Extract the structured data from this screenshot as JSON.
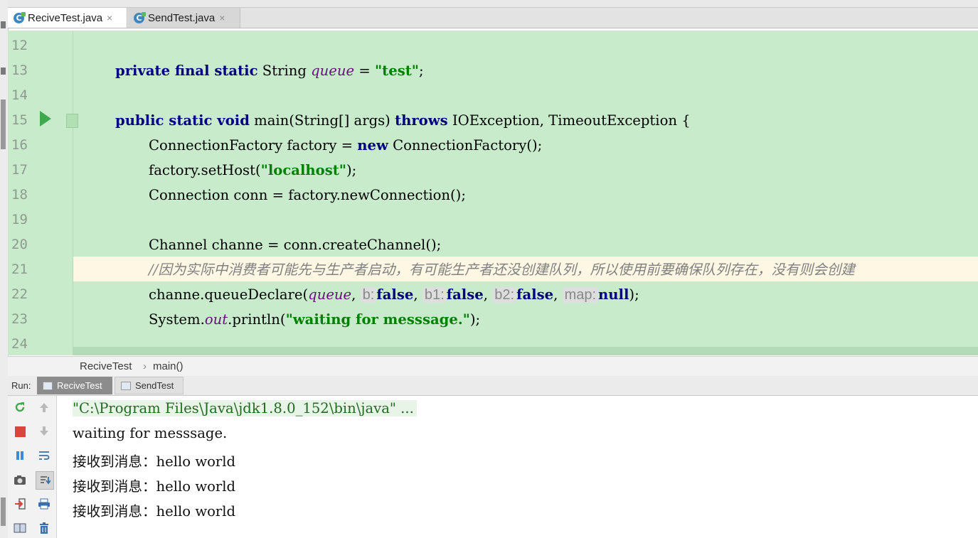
{
  "tabs": [
    {
      "label": "ReciveTest.java",
      "active": true
    },
    {
      "label": "SendTest.java",
      "active": false
    }
  ],
  "tab_close_glyph": "×",
  "editor": {
    "lines": [
      {
        "num": "12"
      },
      {
        "num": "13"
      },
      {
        "num": "14"
      },
      {
        "num": "15"
      },
      {
        "num": "16"
      },
      {
        "num": "17"
      },
      {
        "num": "18"
      },
      {
        "num": "19"
      },
      {
        "num": "20"
      },
      {
        "num": "21"
      },
      {
        "num": "22"
      },
      {
        "num": "23"
      },
      {
        "num": "24"
      }
    ],
    "code": {
      "l13": {
        "kw": "private final static",
        "type": " String ",
        "field": "queue",
        "eq": " = ",
        "str": "\"test\"",
        "end": ";"
      },
      "l15": {
        "kw1": "public static void",
        "mid": " main(String[] args) ",
        "kw2": "throws",
        "end": " IOException, TimeoutException {"
      },
      "l16": {
        "pre": "ConnectionFactory factory = ",
        "kw": "new",
        "end": " ConnectionFactory();"
      },
      "l17": {
        "pre": "factory.setHost(",
        "str": "\"localhost\"",
        "end": ");"
      },
      "l18": {
        "text": "Connection conn = factory.newConnection();"
      },
      "l20": {
        "text": "Channel channe = conn.createChannel();"
      },
      "l21": {
        "comment": "//因为实际中消费者可能先与生产者启动，有可能生产者还没创建队列，所以使用前要确保队列存在，没有则会创建"
      },
      "l22": {
        "pre": "channe.queueDeclare(",
        "field": "queue",
        "c1": ", ",
        "h1": "b:",
        "v1": "false",
        "c2": ", ",
        "h2": "b1:",
        "v2": "false",
        "c3": ", ",
        "h3": "b2:",
        "v3": "false",
        "c4": ", ",
        "h4": "map:",
        "v4": "null",
        "end": ");"
      },
      "l23": {
        "pre": "System.",
        "field": "out",
        "mid": ".println(",
        "str": "\"waiting for messsage.\"",
        "end": ");"
      }
    }
  },
  "breadcrumb": {
    "class": "ReciveTest",
    "sep": "›",
    "method": "main()"
  },
  "run": {
    "label": "Run:",
    "tabs": [
      {
        "label": "ReciveTest",
        "active": true
      },
      {
        "label": "SendTest",
        "active": false
      }
    ]
  },
  "console": {
    "lines": [
      "\"C:\\Program Files\\Java\\jdk1.8.0_152\\bin\\java\" ...",
      "waiting for messsage.",
      "接收到消息：hello world",
      "接收到消息：hello world",
      "接收到消息：hello world"
    ]
  },
  "toolbar_icons": {
    "col1": [
      "rerun-icon",
      "stop-icon",
      "pause-icon",
      "camera-icon",
      "exit-icon",
      "layout-icon"
    ],
    "col2": [
      "up-arrow-icon",
      "down-arrow-icon",
      "soft-wrap-icon",
      "scroll-to-end-icon",
      "print-icon",
      "trash-icon"
    ]
  },
  "colors": {
    "editor_bg": "#c8ebcc",
    "current_line": "#fdf7e4",
    "keyword": "#000080",
    "string": "#008000",
    "field": "#660e7a",
    "comment": "#808080"
  }
}
